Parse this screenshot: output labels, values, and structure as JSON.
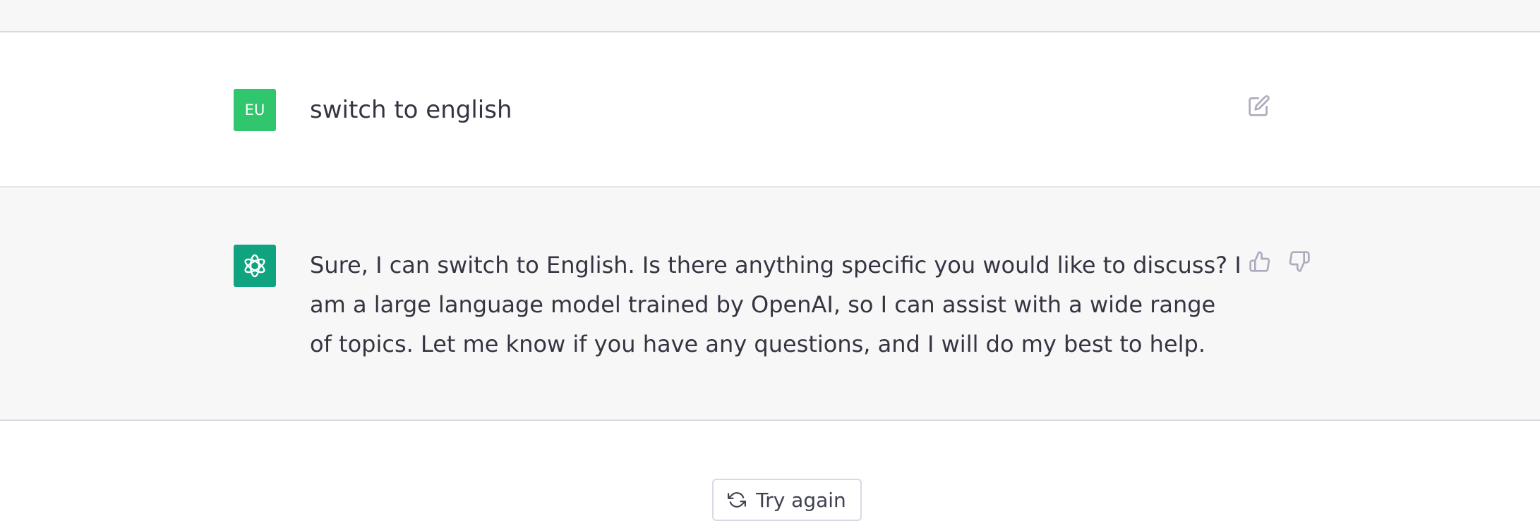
{
  "conversation": {
    "user_message": {
      "avatar_initials": "EU",
      "avatar_color": "#2fc66d",
      "text": "switch to english"
    },
    "assistant_message": {
      "avatar_icon": "openai-logo-icon",
      "avatar_color": "#10a37f",
      "text": "Sure, I can switch to English. Is there anything specific you would like to discuss? I am a large language model trained by OpenAI, so I can assist with a wide range of topics. Let me know if you have any questions, and I will do my best to help."
    }
  },
  "actions": {
    "edit_icon": "edit-icon",
    "thumbs_up_icon": "thumbs-up-icon",
    "thumbs_down_icon": "thumbs-down-icon",
    "try_again_label": "Try again",
    "try_again_icon": "refresh-icon"
  },
  "colors": {
    "text": "#343541",
    "row_alt_background": "#f7f7f8",
    "border": "#d9d9e3",
    "icon": "#acacbe"
  }
}
